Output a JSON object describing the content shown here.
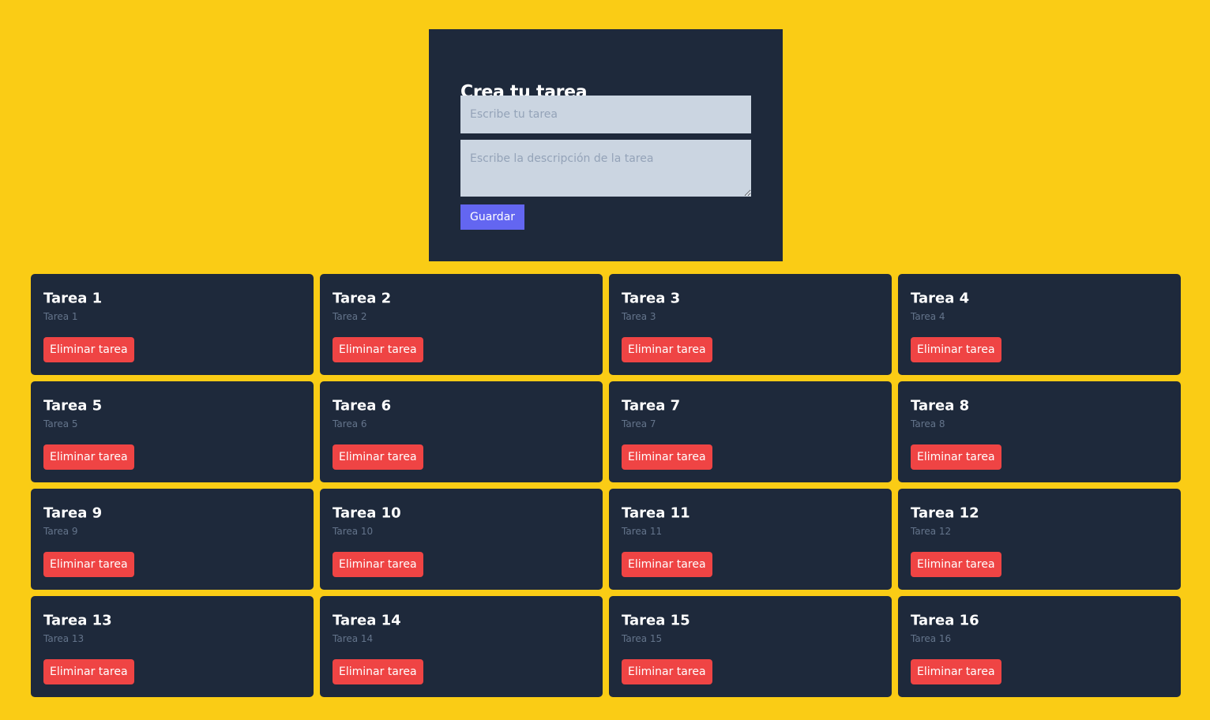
{
  "form": {
    "title": "Crea tu tarea",
    "task_placeholder": "Escribe tu tarea",
    "task_value": "",
    "description_placeholder": "Escribe la descripción de la tarea",
    "description_value": "",
    "save_label": "Guardar"
  },
  "delete_label": "Eliminar tarea",
  "tasks": [
    {
      "title": "Tarea 1",
      "description": "Tarea 1"
    },
    {
      "title": "Tarea 2",
      "description": "Tarea 2"
    },
    {
      "title": "Tarea 3",
      "description": "Tarea 3"
    },
    {
      "title": "Tarea 4",
      "description": "Tarea 4"
    },
    {
      "title": "Tarea 5",
      "description": "Tarea 5"
    },
    {
      "title": "Tarea 6",
      "description": "Tarea 6"
    },
    {
      "title": "Tarea 7",
      "description": "Tarea 7"
    },
    {
      "title": "Tarea 8",
      "description": "Tarea 8"
    },
    {
      "title": "Tarea 9",
      "description": "Tarea 9"
    },
    {
      "title": "Tarea 10",
      "description": "Tarea 10"
    },
    {
      "title": "Tarea 11",
      "description": "Tarea 11"
    },
    {
      "title": "Tarea 12",
      "description": "Tarea 12"
    },
    {
      "title": "Tarea 13",
      "description": "Tarea 13"
    },
    {
      "title": "Tarea 14",
      "description": "Tarea 14"
    },
    {
      "title": "Tarea 15",
      "description": "Tarea 15"
    },
    {
      "title": "Tarea 16",
      "description": "Tarea 16"
    }
  ],
  "colors": {
    "background": "#facc15",
    "card": "#1e293b",
    "input": "#cbd5e1",
    "save_button": "#6366f1",
    "delete_button": "#ef4444",
    "description_text": "#64748b"
  }
}
